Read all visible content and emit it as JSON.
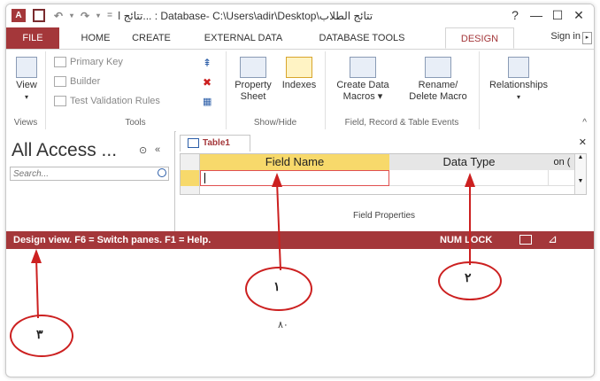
{
  "titlebar": {
    "app_icon": "A",
    "title": "تتائج ا... : Database- C:\\Users\\adir\\Desktop\\تتائج الطلاب",
    "help": "?",
    "minimize": "—",
    "maximize": "☐",
    "close": "✕"
  },
  "tabs": {
    "file": "FILE",
    "home": "HOME",
    "create": "CREATE",
    "external_data": "EXTERNAL DATA",
    "database_tools": "DATABASE TOOLS",
    "design": "DESIGN",
    "sign_in": "Sign in"
  },
  "ribbon": {
    "views": {
      "view": "View",
      "label": "Views"
    },
    "tools": {
      "primary_key": "Primary Key",
      "builder": "Builder",
      "test_validation": "Test Validation Rules",
      "label": "Tools"
    },
    "show_hide": {
      "property_sheet_1": "Property",
      "property_sheet_2": "Sheet",
      "indexes": "Indexes",
      "label": "Show/Hide"
    },
    "field_events": {
      "create_data_1": "Create Data",
      "create_data_2": "Macros ▾",
      "rename_1": "Rename/",
      "rename_2": "Delete Macro",
      "label": "Field, Record & Table Events"
    },
    "relationships": {
      "relationships": "Relationships"
    }
  },
  "nav": {
    "title": "All Access ...",
    "search_placeholder": "Search..."
  },
  "document": {
    "tab_label": "Table1",
    "close": "✕",
    "col_field_name": "Field Name",
    "col_data_type": "Data Type",
    "col_description": "on (",
    "field_properties": "Field Properties"
  },
  "status": {
    "text": "Design view.  F6 = Switch panes.  F1 = Help.",
    "num_lock": "NUM LOCK"
  },
  "annotations": {
    "one": "١",
    "two": "٢",
    "three": "٣"
  },
  "footnote": "٨٠",
  "colors": {
    "accent": "#a4373a",
    "annotation": "#cc2020",
    "header_highlight": "#f7d96b"
  }
}
